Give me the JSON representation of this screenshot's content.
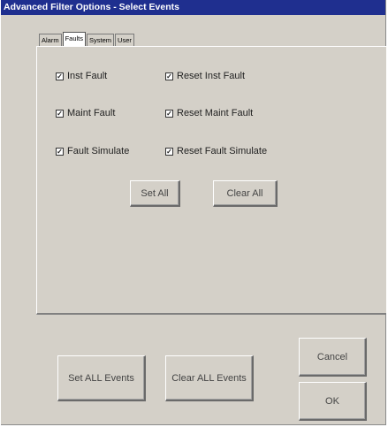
{
  "window": {
    "title": "Advanced Filter Options - Select Events"
  },
  "tabs": [
    {
      "label": "Alarm"
    },
    {
      "label": "Faults",
      "active": true
    },
    {
      "label": "System"
    },
    {
      "label": "User"
    }
  ],
  "checkboxes": [
    {
      "label": "Inst Fault",
      "checked": true
    },
    {
      "label": "Reset Inst Fault",
      "checked": true
    },
    {
      "label": "Maint Fault",
      "checked": true
    },
    {
      "label": "Reset Maint Fault",
      "checked": true
    },
    {
      "label": "Fault Simulate",
      "checked": true
    },
    {
      "label": "Reset Fault Simulate",
      "checked": true
    }
  ],
  "panel_buttons": {
    "set_all": "Set All",
    "clear_all": "Clear All"
  },
  "footer_buttons": {
    "set_all_events": "Set ALL Events",
    "clear_all_events": "Clear ALL Events",
    "cancel": "Cancel",
    "ok": "OK"
  },
  "colors": {
    "titlebar": "#1f2f8f",
    "face": "#d4d0c8"
  },
  "check_glyph": "✓"
}
